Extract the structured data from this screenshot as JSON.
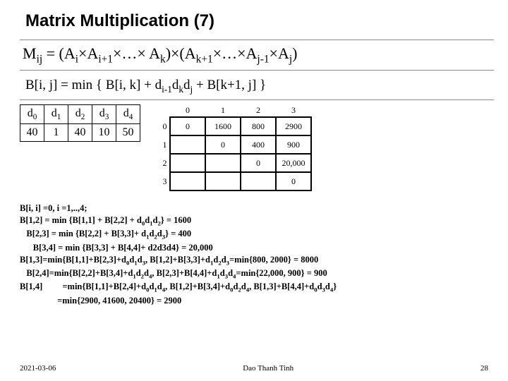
{
  "title": "Matrix Multiplication (7)",
  "formula_html": "M<sub>ij</sub> = (A<sub>i</sub>×A<sub>i+1</sub>×…× A<sub>k</sub>)×(A<sub>k+1</sub>×…×A<sub>j-1</sub>×A<sub>j</sub>)",
  "recurrence_html": "B[i, j]  = min { B[i, k] + d<sub>i-1</sub>d<sub>k</sub>d<sub>j</sub> + B[k+1, j] }",
  "chart_data": [
    {
      "type": "table",
      "title": "d values",
      "headers": [
        "d0",
        "d1",
        "d2",
        "d3",
        "d4"
      ],
      "values": [
        40,
        1,
        40,
        10,
        50
      ]
    },
    {
      "type": "table",
      "title": "B matrix (upper triangle)",
      "col_headers": [
        "0",
        "1",
        "2",
        "3"
      ],
      "row_headers": [
        "0",
        "1",
        "2",
        "3"
      ],
      "cells": [
        [
          "0",
          "1600",
          "800",
          "2900"
        ],
        [
          "",
          "0",
          "400",
          "900"
        ],
        [
          "",
          "",
          "0",
          "20,000"
        ],
        [
          "",
          "",
          "",
          "0"
        ]
      ]
    }
  ],
  "d_table": {
    "headers": [
      "d<sub>0</sub>",
      "d<sub>1</sub>",
      "d<sub>2</sub>",
      "d<sub>3</sub>",
      "d<sub>4</sub>"
    ],
    "values": [
      "40",
      "1",
      "40",
      "10",
      "50"
    ]
  },
  "b_table": {
    "col_headers": [
      "0",
      "1",
      "2",
      "3"
    ],
    "row_headers": [
      "0",
      "1",
      "2",
      "3"
    ],
    "cells": [
      [
        "0",
        "1600",
        "800",
        "2900"
      ],
      [
        "",
        "0",
        "400",
        "900"
      ],
      [
        "",
        "",
        "0",
        "20,000"
      ],
      [
        "",
        "",
        "",
        "0"
      ]
    ]
  },
  "calc_lines_html": [
    "B[i, i] =0, i =1,..,4;",
    "B[1,2] = min {B[1,1] + B[2,2] + d<sub>0</sub>d<sub>1</sub>d<sub>2</sub>} = 1600",
    "   B[2,3] = min {B[2,2] + B[3,3]+ d<sub>1</sub>d<sub>2</sub>d<sub>3</sub>} = 400",
    "      B[3,4] = min {B[3,3] + B[4,4]+ d2d3d4} = 20,000",
    "B[1,3]=min{B[1,1]+B[2,3]+d<sub>0</sub>d<sub>1</sub>d<sub>3</sub>, B[1,2]+B[3,3]+d<sub>1</sub>d<sub>2</sub>d<sub>3</sub>=min{800, 2000} = 8000",
    "   B[2,4]=min{B[2,2]+B[3,4]+d<sub>1</sub>d<sub>2</sub>d<sub>4</sub>, B[2,3]+B[4,4]+d<sub>1</sub>d<sub>3</sub>d<sub>4</sub>=min{22,000, 900} = 900",
    "B[1,4]         =min{B[1,1]+B[2,4]+d<sub>0</sub>d<sub>1</sub>d<sub>4</sub>, B[1,2]+B[3,4]+d<sub>0</sub>d<sub>2</sub>d<sub>4</sub>, B[1,3]+B[4,4]+d<sub>0</sub>d<sub>3</sub>d<sub>4</sub>}",
    "                 =min{2900, 41600, 20400} = 2900"
  ],
  "footer": {
    "date": "2021-03-06",
    "author": "Dao Thanh Tinh",
    "pageno": "28"
  }
}
